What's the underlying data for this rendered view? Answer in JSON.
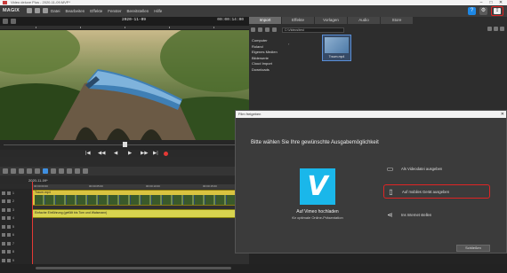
{
  "window": {
    "title": "Video deluxe Plus - 2020-11-09.MVP*",
    "minimize": "–",
    "maximize": "□",
    "close": "✕"
  },
  "menubar": {
    "logo": "MAGIX",
    "items": [
      "Datei",
      "Bearbeiten",
      "Effekte",
      "Fenster",
      "Bereitstellen",
      "Hilfe"
    ],
    "share_icon": "share-icon"
  },
  "monitor": {
    "date": "2020-11-09",
    "timecode": "00:00:14:00",
    "scrub_label": "14:00"
  },
  "media_pool": {
    "tabs": [
      "Import",
      "Effekte",
      "Vorlagen",
      "Audio",
      "Store"
    ],
    "active_tab": "Import",
    "path": "C:\\Videos\\test",
    "folders": [
      "Computer",
      "Roland",
      "Eigenes Medien",
      "Bilderserie",
      "Cloud Import",
      "Downloads"
    ],
    "thumbnail_label": "Traum.mp4"
  },
  "transport": {
    "symbols": [
      "|◀",
      "◀◀",
      "◀",
      "▶",
      "▶▶",
      "▶|"
    ]
  },
  "timeline": {
    "date": "2020-11-09*",
    "ruler_ticks": [
      "00:00:00:00",
      "00:00:05:00",
      "00:00:10:00",
      "00:00:15:00"
    ],
    "video_clip": "Traum.mp4",
    "audio_clip": "Einfache Einführung (gefüllt bis Tom und Walsmann)",
    "track_labels": [
      "1",
      "2",
      "3",
      "4",
      "5",
      "6",
      "7",
      "8",
      "9"
    ]
  },
  "export_dialog": {
    "title": "Film freigeben",
    "heading": "Bitte wählen Sie Ihre gewünschte Ausgabemöglichkeit",
    "vimeo": {
      "logo": "V",
      "title": "Auf Vimeo hochladen",
      "subtitle": "für optimale Online-Präsentation"
    },
    "options": [
      {
        "icon": "folder-icon",
        "label": "Als Videodatei ausgeben"
      },
      {
        "icon": "tablet-icon",
        "label": "Auf mobiles Gerät ausgeben"
      },
      {
        "icon": "share-icon",
        "label": "Ins Internet stellen"
      }
    ],
    "highlight_color": "#e02424",
    "button": "Schließen"
  }
}
